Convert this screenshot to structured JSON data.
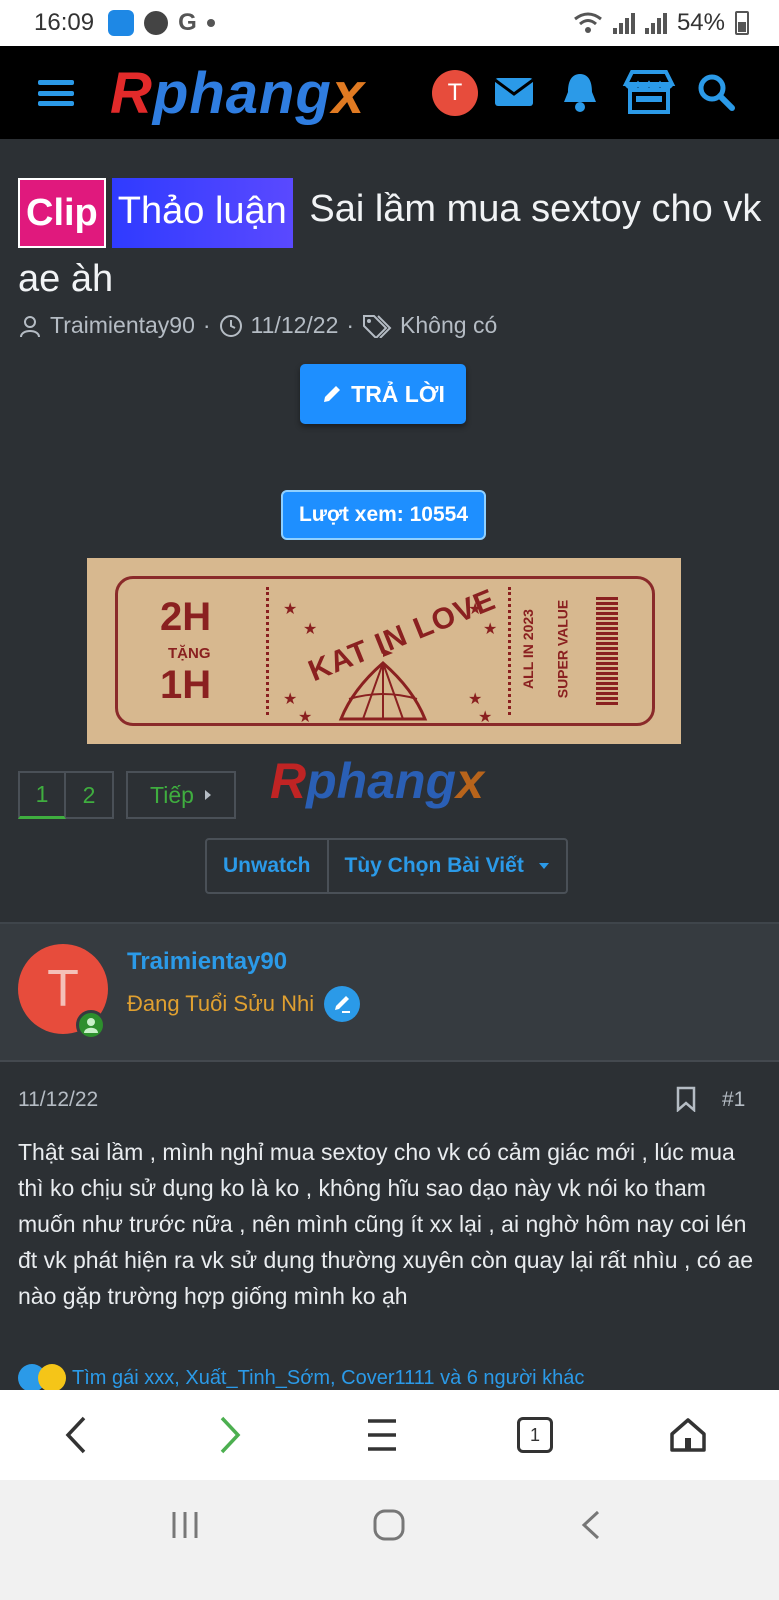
{
  "status": {
    "time": "16:09",
    "icons": [
      "wifi-calling-icon",
      "facebook-icon",
      "google-icon",
      "dot-icon"
    ],
    "g_letter": "G",
    "battery": "54%"
  },
  "header": {
    "logo_r": "R",
    "logo_mid": "phang",
    "logo_x": "x",
    "avatar_letter": "T",
    "icons": [
      "menu-icon",
      "mail-icon",
      "bell-icon",
      "store-icon",
      "search-icon"
    ]
  },
  "thread": {
    "prefix_clip": "Clip",
    "prefix_discussion": "Thảo luận",
    "title": "Sai lầm mua sextoy cho vk ae àh",
    "author": "Traimientay90",
    "date": "11/12/22",
    "tags": "Không có",
    "reply_button": "TRẢ LỜI",
    "views": "Lượt xem: 10554"
  },
  "banner": {
    "left_top": "2H",
    "left_mid": "TẶNG",
    "left_bottom": "1H",
    "center": "KAT IN LOVE",
    "right_1": "ALL IN 2023",
    "right_2": "SUPER VALUE"
  },
  "pagination": {
    "pages": [
      "1",
      "2"
    ],
    "active": "1",
    "next": "Tiếp"
  },
  "actions": {
    "unwatch": "Unwatch",
    "options": "Tùy Chọn Bài Viết"
  },
  "post": {
    "avatar_letter": "T",
    "username": "Traimientay90",
    "user_title": "Đang Tuổi Sửu Nhi",
    "date": "11/12/22",
    "number": "#1",
    "body": "Thật sai lầm , mình nghỉ mua sextoy cho vk có cảm giác mới , lúc mua thì ko chịu sử dụng ko là ko , không hĩu sao dạo này vk nói ko tham muốn như trước nữa , nên mình cũng ít xx lại , ai nghờ hôm nay coi lén đt vk phát hiện ra vk sử dụng thường xuyên còn quay lại rất nhìu , có ae nào gặp trường hợp giống mình ko ạh",
    "reactions": "Tìm gái xxx, Xuất_Tinh_Sớm, Cover1111 và 6 người khác"
  },
  "browser": {
    "tab_count": "1",
    "icons": [
      "back-icon",
      "forward-icon",
      "menu-icon",
      "tabs-icon",
      "home-icon"
    ]
  },
  "colors": {
    "accent": "#1e8fff",
    "link": "#2b9ae8",
    "page_bg": "#2c3034",
    "green": "#3fae3f",
    "user_title": "#e0a030"
  }
}
